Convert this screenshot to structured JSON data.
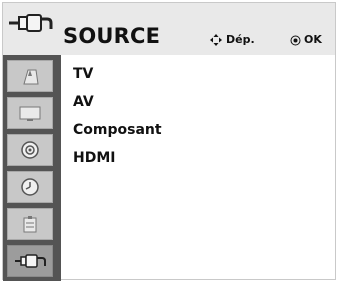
{
  "header": {
    "title": "SOURCE",
    "hints": {
      "move_label": "Dép.",
      "ok_label": "OK"
    },
    "icon": "source-connector-icon"
  },
  "sidebar": {
    "items": [
      {
        "icon": "picture-icon"
      },
      {
        "icon": "screen-icon"
      },
      {
        "icon": "audio-icon"
      },
      {
        "icon": "clock-icon"
      },
      {
        "icon": "option-icon"
      },
      {
        "icon": "source-connector-icon",
        "active": true
      }
    ]
  },
  "list": {
    "items": [
      {
        "label": "TV"
      },
      {
        "label": "AV"
      },
      {
        "label": "Composant"
      },
      {
        "label": "HDMI"
      }
    ]
  }
}
